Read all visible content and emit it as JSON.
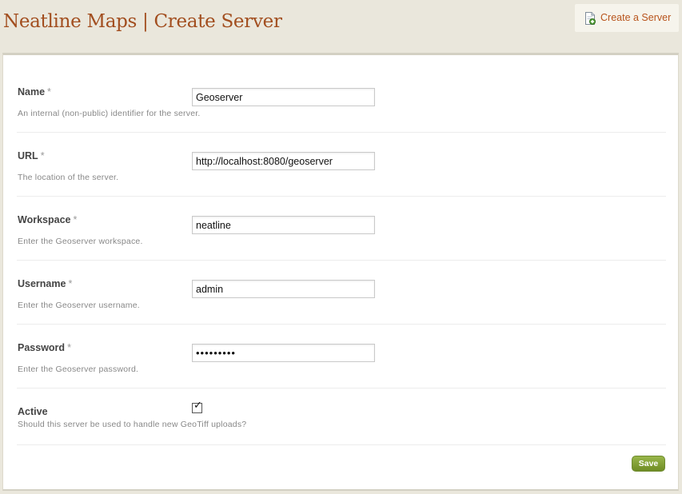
{
  "header": {
    "title": "Neatline Maps | Create Server",
    "create_link": "Create a Server",
    "create_link_icon": "document-add-icon",
    "title_color": "#a24e1f",
    "link_color": "#b8541c"
  },
  "form": {
    "required_marker": "*",
    "fields": [
      {
        "label": "Name",
        "required": true,
        "hint": "An internal (non-public) identifier for the server.",
        "value": "Geoserver"
      },
      {
        "label": "URL",
        "required": true,
        "hint": "The location of the server.",
        "value": "http://localhost:8080/geoserver"
      },
      {
        "label": "Workspace",
        "required": true,
        "hint": "Enter the Geoserver workspace.",
        "value": "neatline"
      },
      {
        "label": "Username",
        "required": true,
        "hint": "Enter the Geoserver username.",
        "value": "admin"
      },
      {
        "label": "Password",
        "required": true,
        "hint": "Enter the Geoserver password.",
        "value": "•••••••••"
      }
    ],
    "active": {
      "label": "Active",
      "hint": "Should this server be used to handle new GeoTiff uploads?",
      "checked": true,
      "checkmark": "✓"
    },
    "save_label": "Save",
    "save_color": "#7a9a2f"
  }
}
